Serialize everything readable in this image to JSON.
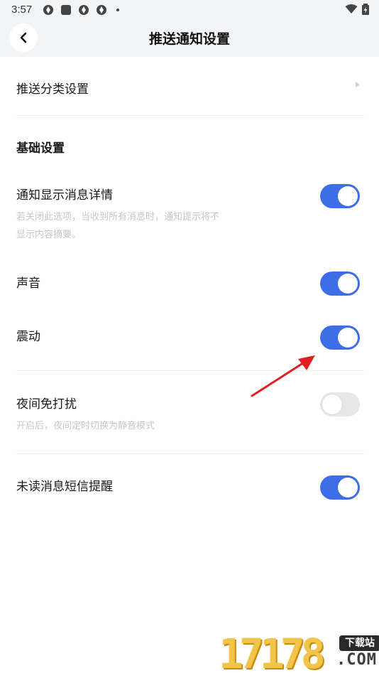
{
  "status_bar": {
    "time": "3:57",
    "icons": [
      "aperture-icon",
      "square-app-icon",
      "aperture-icon",
      "aperture-icon",
      "dot-icon"
    ],
    "right_icons": [
      "wifi-icon",
      "battery-charging-icon"
    ]
  },
  "header": {
    "title": "推送通知设置",
    "back_icon": "chevron-left-icon"
  },
  "push_category": {
    "label": "推送分类设置",
    "icon": "chevron-right-icon"
  },
  "basic_section": {
    "title": "基础设置"
  },
  "settings": [
    {
      "label": "通知显示消息详情",
      "description": "若关闭此选项，当收到所有消息时，通知提示将不显示内容摘要。",
      "enabled": true
    },
    {
      "label": "声音",
      "enabled": true
    },
    {
      "label": "震动",
      "enabled": true
    },
    {
      "label": "夜间免打扰",
      "description": "开启后，夜间定时切换为静音模式",
      "enabled": false
    },
    {
      "label": "未读消息短信提醒",
      "enabled": true
    }
  ],
  "colors": {
    "accent": "#3d6ee8",
    "toggle_off": "#e7e7e7",
    "annotation_arrow": "#e02020",
    "header_bg": "#f3f4f6"
  },
  "watermark": {
    "number": "17178",
    "badge": "下载站",
    "domain": ".COM"
  }
}
